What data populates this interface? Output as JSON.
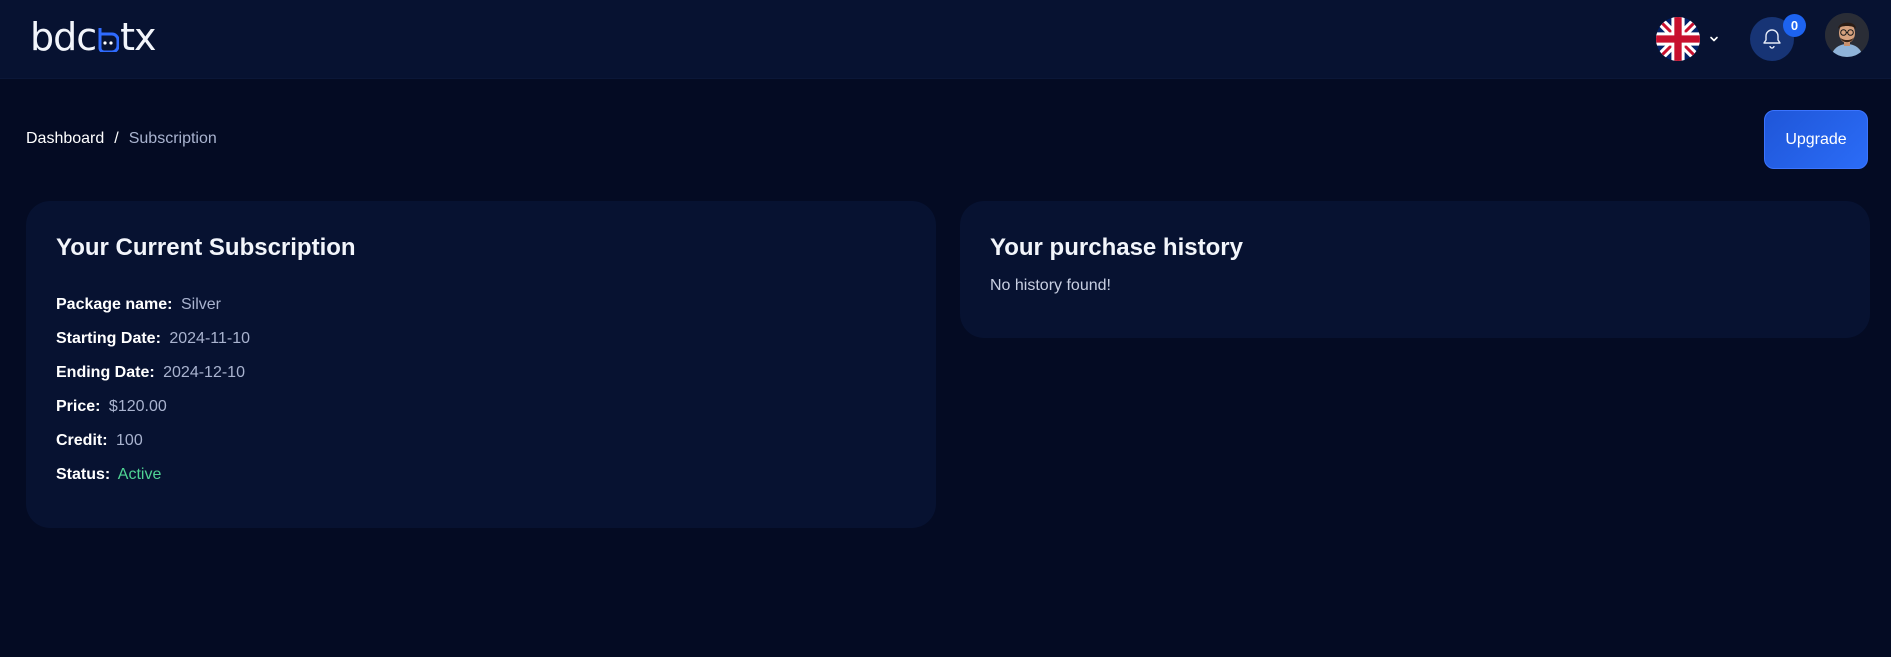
{
  "header": {
    "logo_text_left": "bdc",
    "logo_text_right": "tx",
    "language": {
      "flag_icon": "uk-flag-icon",
      "chevron_icon": "chevron-down-icon"
    },
    "notifications": {
      "icon": "bell-icon",
      "count": "0"
    },
    "avatar": {
      "icon": "user-avatar"
    }
  },
  "breadcrumb": {
    "home": "Dashboard",
    "separator": "/",
    "current": "Subscription"
  },
  "upgrade_button": "Upgrade",
  "subscription": {
    "title": "Your Current Subscription",
    "rows": [
      {
        "label": "Package name:",
        "value": "Silver"
      },
      {
        "label": "Starting Date:",
        "value": "2024-11-10"
      },
      {
        "label": "Ending Date:",
        "value": "2024-12-10"
      },
      {
        "label": "Price:",
        "value": "$120.00"
      },
      {
        "label": "Credit:",
        "value": "100"
      },
      {
        "label": "Status:",
        "value": "Active"
      }
    ],
    "status_color": "#4fd494"
  },
  "history": {
    "title": "Your purchase history",
    "empty_text": "No history found!"
  },
  "colors": {
    "background": "#040b23",
    "panel": "#071231",
    "accent": "#1f56d8"
  }
}
